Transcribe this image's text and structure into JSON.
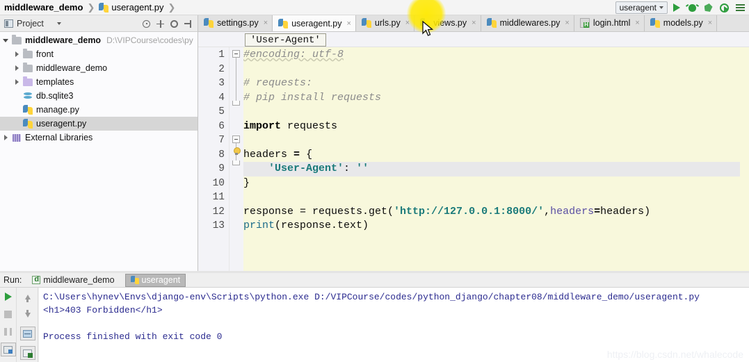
{
  "breadcrumb": {
    "project": "middleware_demo",
    "separator": "❯",
    "file": "useragent.py",
    "file_icon": "python-file-icon"
  },
  "toolbar": {
    "run_config": "useragent",
    "run_config_caret": "chevron-down-icon",
    "buttons": [
      {
        "name": "run-button",
        "icon": "run-triangle-icon"
      },
      {
        "name": "debug-button",
        "icon": "bug-icon"
      },
      {
        "name": "run-with-coverage-button",
        "icon": "coverage-icon"
      },
      {
        "name": "profile-button",
        "icon": "profiler-icon"
      },
      {
        "name": "more-toolbar-button",
        "icon": "bars-icon"
      }
    ]
  },
  "project_panel": {
    "title": "Project",
    "title_icon": "project-icon",
    "title_caret": "chevron-down-icon",
    "tools": [
      {
        "name": "scroll-from-source-button",
        "icon": "target-icon"
      },
      {
        "name": "collapse-all-button",
        "icon": "collapse-all-icon"
      },
      {
        "name": "settings-button",
        "icon": "gear-icon"
      },
      {
        "name": "hide-panel-button",
        "icon": "hide-panel-icon"
      }
    ],
    "tree": [
      {
        "label": "middleware_demo",
        "path": "D:\\VIPCourse\\codes\\py",
        "icon": "folder-icon",
        "arrow": "open",
        "indent": 0,
        "bold": true,
        "selected": false
      },
      {
        "label": "front",
        "path": "",
        "icon": "folder-icon",
        "arrow": "closed",
        "indent": 1,
        "bold": false,
        "selected": false
      },
      {
        "label": "middleware_demo",
        "path": "",
        "icon": "folder-icon",
        "arrow": "closed",
        "indent": 1,
        "bold": false,
        "selected": false
      },
      {
        "label": "templates",
        "path": "",
        "icon": "folder-violet-icon",
        "arrow": "closed",
        "indent": 1,
        "bold": false,
        "selected": false
      },
      {
        "label": "db.sqlite3",
        "path": "",
        "icon": "database-icon",
        "arrow": "none",
        "indent": 1,
        "bold": false,
        "selected": false
      },
      {
        "label": "manage.py",
        "path": "",
        "icon": "python-file-icon",
        "arrow": "none",
        "indent": 1,
        "bold": false,
        "selected": false
      },
      {
        "label": "useragent.py",
        "path": "",
        "icon": "python-file-icon",
        "arrow": "none",
        "indent": 1,
        "bold": false,
        "selected": true
      },
      {
        "label": "External Libraries",
        "path": "",
        "icon": "library-icon",
        "arrow": "closed",
        "indent": 0,
        "bold": false,
        "selected": false
      }
    ]
  },
  "editor_tabs": [
    {
      "label": "settings.py",
      "icon": "python-file-icon",
      "active": false,
      "close": "×"
    },
    {
      "label": "useragent.py",
      "icon": "python-file-icon",
      "active": true,
      "close": "×"
    },
    {
      "label": "urls.py",
      "icon": "python-file-icon",
      "active": false,
      "close": "×"
    },
    {
      "label": "views.py",
      "icon": "python-file-icon",
      "active": false,
      "close": "×"
    },
    {
      "label": "middlewares.py",
      "icon": "python-file-icon",
      "active": false,
      "close": "×"
    },
    {
      "label": "login.html",
      "icon": "html-file-icon",
      "active": false,
      "close": "×"
    },
    {
      "label": "models.py",
      "icon": "python-file-icon",
      "active": false,
      "close": "×"
    }
  ],
  "editor": {
    "breadcrumb_chip": "'User-Agent'",
    "current_line": 9,
    "line_numbers": [
      1,
      2,
      3,
      4,
      5,
      6,
      7,
      8,
      9,
      10,
      11,
      12,
      13
    ],
    "lines": [
      {
        "n": 1,
        "text": "#encoding: utf-8"
      },
      {
        "n": 2,
        "text": ""
      },
      {
        "n": 3,
        "text": "# requests:"
      },
      {
        "n": 4,
        "text": "# pip install requests"
      },
      {
        "n": 5,
        "text": ""
      },
      {
        "n": 6,
        "text": "import requests"
      },
      {
        "n": 7,
        "text": ""
      },
      {
        "n": 8,
        "text": "headers = {"
      },
      {
        "n": 9,
        "text": "    'User-Agent': ''"
      },
      {
        "n": 10,
        "text": "}"
      },
      {
        "n": 11,
        "text": ""
      },
      {
        "n": 12,
        "text": "response = requests.get('http://127.0.0.1:8000/',headers=headers)"
      },
      {
        "n": 13,
        "text": "print(response.text)"
      }
    ]
  },
  "run_panel": {
    "label": "Run:",
    "tabs": [
      {
        "label": "middleware_demo",
        "icon": "django-icon",
        "active": false
      },
      {
        "label": "useragent",
        "icon": "python-file-icon",
        "active": true
      }
    ],
    "gutter_buttons": [
      {
        "name": "rerun-button",
        "icon": "run-triangle-icon"
      },
      {
        "name": "stop-button",
        "icon": "stop-icon"
      },
      {
        "name": "pause-output-button",
        "icon": "pause-icon"
      },
      {
        "name": "print-button",
        "icon": "print-icon"
      },
      {
        "name": "scroll-up-button",
        "icon": "arrow-up-icon"
      },
      {
        "name": "scroll-down-button",
        "icon": "arrow-down-icon"
      },
      {
        "name": "soft-wrap-button",
        "icon": "soft-wrap-icon"
      },
      {
        "name": "export-output-button",
        "icon": "export-icon"
      }
    ],
    "console": [
      "C:\\Users\\hynev\\Envs\\django-env\\Scripts\\python.exe D:/VIPCourse/codes/python_django/chapter08/middleware_demo/useragent.py",
      "<h1>403 Forbidden</h1>",
      "",
      "Process finished with exit code 0"
    ]
  },
  "watermark": "https://blog.csdn.net/whalecode",
  "colors": {
    "editor_bg": "#f8f8dc",
    "accent_green": "#2e9e3e",
    "string_token": "#1a7a7a",
    "comment_token": "#8c8c8c",
    "console_text": "#2b2b8f",
    "click_highlight": "#ffe900"
  }
}
